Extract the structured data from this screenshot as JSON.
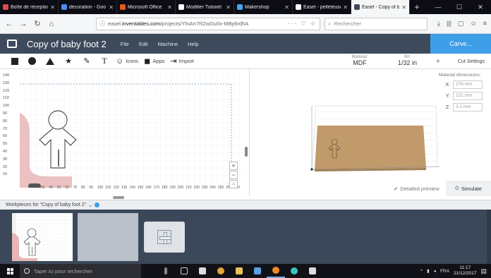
{
  "browser": {
    "tabs": [
      {
        "label": "Boîte de réceptio",
        "favicon_color": "#e04a4a",
        "active": false
      },
      {
        "label": "décoration - Goo",
        "favicon_color": "#4c8bf5",
        "active": false
      },
      {
        "label": "Microsoft Office",
        "favicon_color": "#e8561c",
        "active": false
      },
      {
        "label": "Modifier Tutoriel",
        "favicon_color": "#ffffff",
        "active": false
      },
      {
        "label": "Makershop",
        "favicon_color": "#3fa9f5",
        "active": false
      },
      {
        "label": "Easel - pelleteuse",
        "favicon_color": "#ffffff",
        "active": false
      },
      {
        "label": "Easel - Copy of b",
        "favicon_color": "#3d4a5c",
        "active": true
      }
    ],
    "new_tab_glyph": "+",
    "window_controls": [
      "—",
      "☐",
      "✕"
    ],
    "url_prefix": "easel.",
    "url_host": "inventables.com",
    "url_path": "/projects/YlnAn7RZwDu0x-MBy6rdhA",
    "url_actions": "··· ♡ ☆",
    "search_placeholder": "Rechercher",
    "toolbar_icons": [
      "⤓",
      "|||",
      "▢",
      "☺",
      "≡"
    ]
  },
  "app": {
    "project_title": "Copy of baby foot 2",
    "menu": [
      "File",
      "Edit",
      "Machine",
      "Help"
    ],
    "carve_label": "Carve..."
  },
  "tools": {
    "icons_label": "Icons",
    "apps_label": "Apps",
    "import_label": "Import",
    "material_key": "Material:",
    "material_value": "MDF",
    "bit_key": "Bit:",
    "bit_value": "1/32 in",
    "plus_glyph": "+",
    "cut_settings_label": "Cut Settings"
  },
  "canvas": {
    "y_ticks": [
      "140",
      "130",
      "120",
      "110",
      "100",
      "90",
      "80",
      "70",
      "60",
      "50",
      "40",
      "30",
      "20",
      "10"
    ],
    "x_ticks": [
      "30",
      "40",
      "50",
      "60",
      "70",
      "80",
      "90",
      "100",
      "110",
      "120",
      "130",
      "140",
      "150",
      "160",
      "170",
      "180",
      "190",
      "200",
      "210",
      "220",
      "230",
      "240",
      "250",
      "260",
      "270"
    ]
  },
  "dimensions": {
    "title": "Material dimensions:",
    "x_label": "X:",
    "x_value": "278 mm",
    "y_label": "Y:",
    "y_value": "131 mm",
    "z_label": "Z:",
    "z_value": "3.1 mm"
  },
  "preview": {
    "detailed_label": "Detailed preview",
    "simulate_label": "Simulate"
  },
  "workpieces": {
    "label": "Workpieces for \"Copy of baby foot 2\""
  },
  "taskbar": {
    "search_placeholder": "Taper ici pour rechercher",
    "language": "FRA",
    "time": "11:17",
    "date": "21/12/2017"
  }
}
